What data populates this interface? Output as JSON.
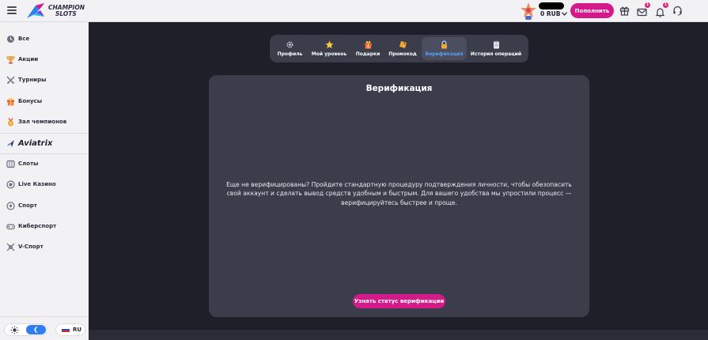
{
  "header": {
    "logo_line1": "CHAMPION",
    "logo_line2": "SLOTS",
    "balance": "0 RUB",
    "deposit_label": "Пополнить",
    "mail_badge": "1",
    "bell_badge": "1",
    "accent_color": "#d41a8a"
  },
  "sidebar": {
    "items": [
      {
        "label": "Все",
        "icon": "clock-icon"
      },
      {
        "label": "Акции",
        "icon": "trophy-icon"
      },
      {
        "label": "Турниры",
        "icon": "swords-icon"
      },
      {
        "label": "Бонусы",
        "icon": "gift-icon"
      },
      {
        "label": "Зал чемпионов",
        "icon": "medal-icon"
      },
      {
        "label": "Aviatrix",
        "icon": "plane-icon"
      },
      {
        "label": "Слоты",
        "icon": "slots-icon"
      },
      {
        "label": "Live Казино",
        "icon": "chip-icon"
      },
      {
        "label": "Спорт",
        "icon": "ball-icon"
      },
      {
        "label": "Киберспорт",
        "icon": "gamepad-icon"
      },
      {
        "label": "V-Спорт",
        "icon": "v-sport-icon"
      }
    ],
    "language": "RU"
  },
  "tabs": [
    {
      "label": "Профиль",
      "icon": "gear-icon"
    },
    {
      "label": "Мой уровень",
      "icon": "star-icon"
    },
    {
      "label": "Подарки",
      "icon": "gift-icon"
    },
    {
      "label": "Промокод",
      "icon": "ticket-icon"
    },
    {
      "label": "Верификация",
      "icon": "lock-icon",
      "active": true
    },
    {
      "label": "История операций",
      "icon": "clipboard-icon"
    }
  ],
  "verification": {
    "title": "Верификация",
    "text": "Еще не верифицированы? Пройдите стандартную процедуру подтверждения личности, чтобы обезопасить свой аккаунт и сделать вывод средств удобным и быстрым. Для вашего удобства мы упростили процесс — верифицируйтесь быстрее и проще.",
    "button_label": "Узнать статус верификации"
  }
}
